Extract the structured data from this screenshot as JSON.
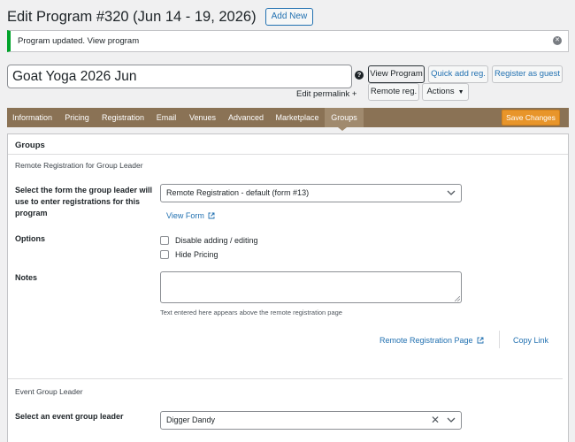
{
  "header": {
    "title": "Edit Program #320 (Jun 14 - 19, 2026)",
    "add_new": "Add New"
  },
  "notice": {
    "text": "Program updated. View program"
  },
  "program": {
    "title_value": "Goat Yoga 2026 Jun",
    "permalink": "Edit permalink +"
  },
  "actions": {
    "help": "?",
    "view_program": "View Program",
    "quick_add": "Quick add reg.",
    "register_guest": "Register as guest",
    "remote_reg": "Remote reg.",
    "actions": "Actions"
  },
  "tabs": [
    {
      "label": "Information"
    },
    {
      "label": "Pricing"
    },
    {
      "label": "Registration"
    },
    {
      "label": "Email"
    },
    {
      "label": "Venues"
    },
    {
      "label": "Advanced"
    },
    {
      "label": "Marketplace"
    },
    {
      "label": "Groups"
    }
  ],
  "save_changes": "Save Changes",
  "groups": {
    "panel_title": "Groups",
    "remote_section": "Remote Registration for Group Leader",
    "form_label": "Select the form the group leader will use to enter registrations for this program",
    "form_selected": "Remote Registration - default (form #13)",
    "view_form": "View Form",
    "options_label": "Options",
    "option_disable": "Disable adding / editing",
    "option_hide_pricing": "Hide Pricing",
    "notes_label": "Notes",
    "notes_hint": "Text entered here appears above the remote registration page",
    "remote_page_link": "Remote Registration Page",
    "copy_link": "Copy Link",
    "leader_section": "Event Group Leader",
    "leader_label": "Select an event group leader",
    "leader_selected": "Digger Dandy"
  },
  "colors": {
    "tab_bar": "#8a7255",
    "tab_active": "#a08a6e",
    "save_button": "#e8952a",
    "link": "#2271b1",
    "notice_success": "#00a32a"
  }
}
